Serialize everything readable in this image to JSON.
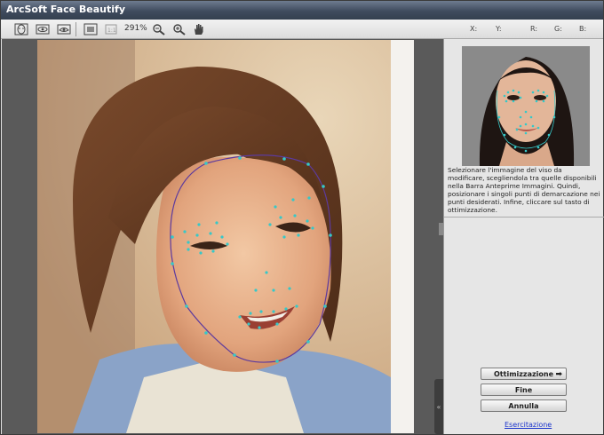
{
  "window": {
    "title": "ArcSoft Face Beautify"
  },
  "toolbar": {
    "zoom_level": "291%",
    "coords": {
      "x_label": "X:",
      "y_label": "Y:",
      "r_label": "R:",
      "g_label": "G:",
      "b_label": "B:"
    },
    "icons": [
      "face-detect-icon",
      "eye-tool-icon",
      "eye-tool-2-icon",
      "fit-screen-icon",
      "actual-size-icon",
      "zoom-out-icon",
      "zoom-in-icon",
      "hand-pan-icon"
    ]
  },
  "side_panel": {
    "instructions": "Selezionare l'immagine del viso da modificare, scegliendola tra quelle disponibili nella Barra Anteprime Immagini. Quindi, posizionare i singoli punti di demarcazione nei punti desiderati. Infine, cliccare sul tasto di ottimizzazione.",
    "buttons": {
      "optimize": "Ottimizzazione",
      "finish": "Fine",
      "cancel": "Annulla"
    },
    "tutorial_link": "Esercitazione"
  },
  "colors": {
    "landmark": "#36c8c8",
    "contour": "#5c3a9e",
    "title_bar": "#3f4b5e"
  }
}
